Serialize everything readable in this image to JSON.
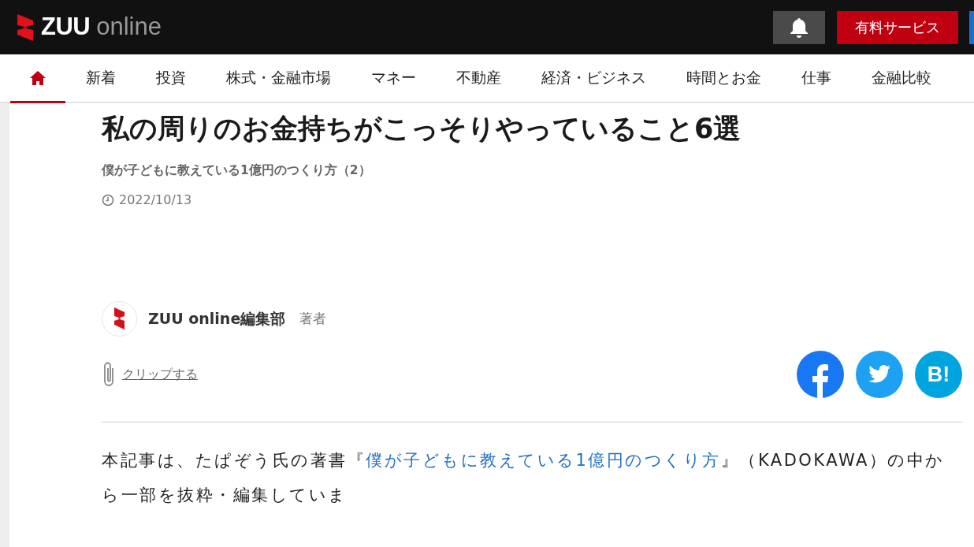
{
  "header": {
    "logo": {
      "brand": "ZUU",
      "suffix": "online"
    },
    "paid_button": "有料サービス"
  },
  "nav": [
    {
      "kind": "home",
      "selected": true
    },
    {
      "label": "新着",
      "selected": false
    },
    {
      "label": "投資",
      "selected": false
    },
    {
      "label": "株式・金融市場",
      "selected": false
    },
    {
      "label": "マネー",
      "selected": false
    },
    {
      "label": "不動産",
      "selected": false
    },
    {
      "label": "経済・ビジネス",
      "selected": false
    },
    {
      "label": "時間とお金",
      "selected": false
    },
    {
      "label": "仕事",
      "selected": false
    },
    {
      "label": "金融比較",
      "selected": false
    }
  ],
  "article": {
    "title": "私の周りのお金持ちがこっそりやっていること6選",
    "subtitle": "僕が子どもに教えている1億円のつくり方（2）",
    "date": "2022/10/13",
    "author": {
      "name": "ZUU online編集部",
      "role": "著者"
    },
    "clip": "クリップする",
    "share": [
      {
        "kind": "facebook"
      },
      {
        "kind": "twitter"
      },
      {
        "kind": "hatena",
        "label": "B!"
      }
    ],
    "body": {
      "before": "本記事は、たぱぞう氏の著書『",
      "link": "僕が子どもに教えている1億円のつくり方",
      "after": "』（KADOKAWA）の中から一部を抜粋・編集していま"
    }
  }
}
